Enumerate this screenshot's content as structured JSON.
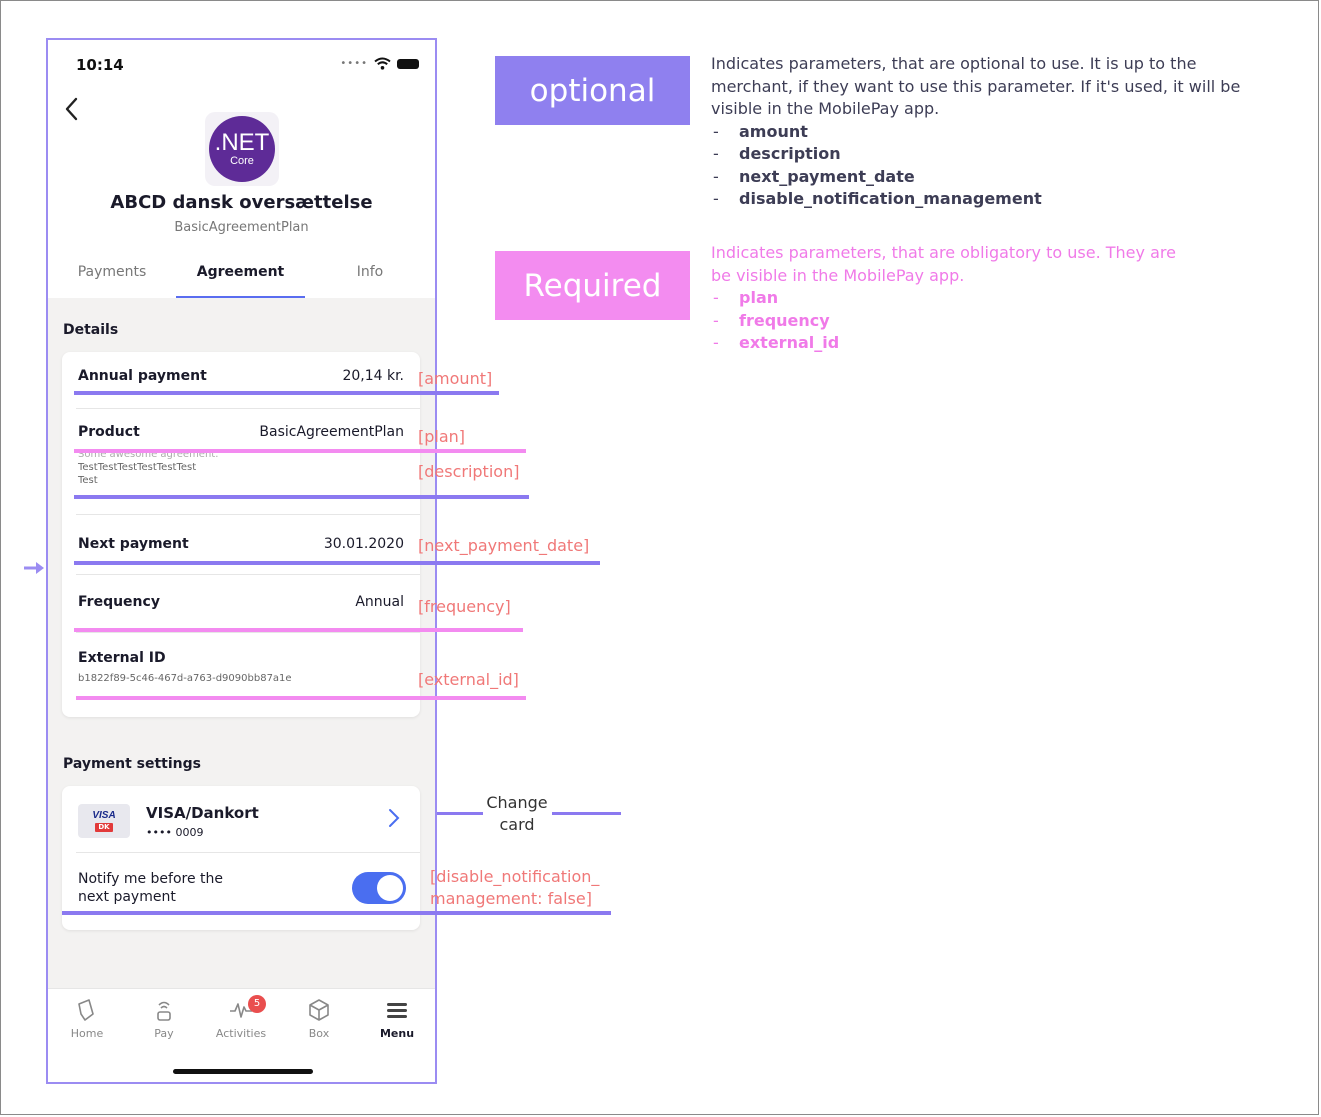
{
  "status_bar": {
    "time": "10:14"
  },
  "merchant": {
    "logo_main": ".NET",
    "logo_sub": "Core",
    "name": "ABCD dansk oversættelse",
    "plan": "BasicAgreementPlan"
  },
  "tabs": {
    "payments": "Payments",
    "agreement": "Agreement",
    "info": "Info"
  },
  "details": {
    "title": "Details",
    "annual_payment_label": "Annual payment",
    "annual_payment_value": "20,14 kr.",
    "product_label": "Product",
    "product_value": "BasicAgreementPlan",
    "description_line1": "Some awesome agreement.",
    "description_line2": "TestTestTestTestTestTest",
    "description_line3": "Test",
    "next_payment_label": "Next payment",
    "next_payment_value": "30.01.2020",
    "frequency_label": "Frequency",
    "frequency_value": "Annual",
    "external_id_label": "External ID",
    "external_id_value": "b1822f89-5c46-467d-a763-d9090bb87a1e"
  },
  "payment_settings": {
    "title": "Payment settings",
    "card_logo_text": "VISA",
    "card_logo_sub": "DK",
    "card_name": "VISA/Dankort",
    "card_number": "•••• 0009",
    "notify_label": "Notify me before the next payment",
    "notify_enabled": true
  },
  "tabbar": {
    "home": "Home",
    "pay": "Pay",
    "activities": "Activities",
    "activities_badge": "5",
    "box": "Box",
    "menu": "Menu"
  },
  "annotations": {
    "amount": "[amount]",
    "plan": "[plan]",
    "description": "[description]",
    "next_payment_date": "[next_payment_date]",
    "frequency": "[frequency]",
    "external_id": "[external_id]",
    "disable_notification_line1": "[disable_notification_",
    "disable_notification_line2": "management: false]",
    "change_card_line1": "Change",
    "change_card_line2": "card"
  },
  "legend": {
    "optional": {
      "label": "optional",
      "color": "#8f80ef",
      "description_line1": "Indicates parameters, that are optional to use. It is up to the",
      "description_line2": "merchant, if they want to use this parameter.  If it's used, it will be",
      "description_line3": "visible in the MobilePay app.",
      "params": [
        "amount",
        "description",
        "next_payment_date",
        "disable_notification_management"
      ]
    },
    "required": {
      "label": "Required",
      "color": "#f38cf0",
      "description_line1": "Indicates parameters, that are obligatory to use.   They are",
      "description_line2": "be visible in the MobilePay app.",
      "params": [
        "plan",
        "frequency",
        "external_id"
      ]
    }
  }
}
